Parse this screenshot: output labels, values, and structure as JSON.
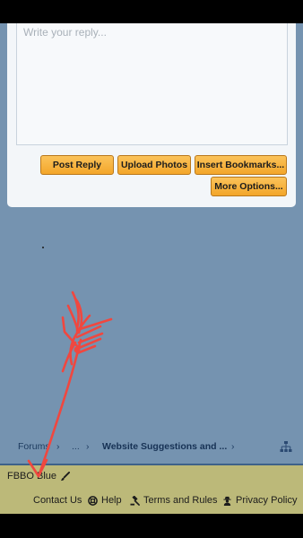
{
  "reply": {
    "placeholder": "Write your reply...",
    "buttons": {
      "post_reply": "Post Reply",
      "upload_photos": "Upload Photos",
      "insert_bookmarks": "Insert Bookmarks...",
      "more_options": "More Options..."
    }
  },
  "breadcrumb": {
    "items": [
      "Forums",
      "...",
      "Website Suggestions and ..."
    ],
    "separator": "›"
  },
  "footer": {
    "style_name": "FBBO Blue",
    "links": {
      "contact": "Contact Us",
      "help": "Help",
      "terms": "Terms and Rules",
      "privacy": "Privacy Policy"
    }
  },
  "colors": {
    "page_bg": "#7593b0",
    "button": "#f3a62a",
    "footer_bg": "#bcb979",
    "annotation": "#f0473f"
  }
}
